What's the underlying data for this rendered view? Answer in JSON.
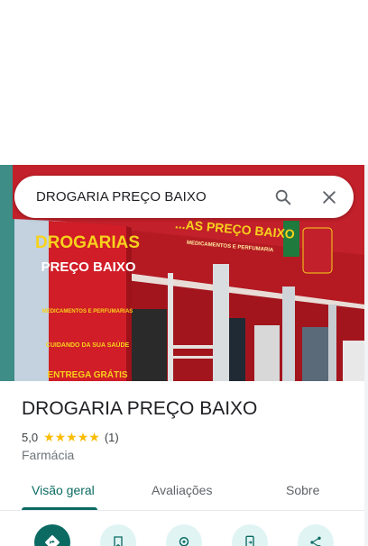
{
  "search": {
    "query": "DROGARIA PREÇO BAIXO",
    "search_icon": "search-icon",
    "close_icon": "close-icon"
  },
  "photo": {
    "sign_line1": "DROGARIAS",
    "sign_line2": "PREÇO BAIXO",
    "sign_line3": "MEDICAMENTOS E PERFUMARIAS",
    "sign_line4": "CUIDANDO DA SUA SAÚDE",
    "sign_line5": "ENTREGA GRÁTIS",
    "facade_text": "...AS PREÇO BAIXO",
    "facade_sub": "MEDICAMENTOS E PERFUMARIA",
    "colors": {
      "sign_red": "#cf1b24",
      "wall_red": "#b51a22",
      "sign_white": "#ffffff",
      "sign_yellow": "#f7d21c"
    }
  },
  "place": {
    "name": "DROGARIA PREÇO BAIXO",
    "rating": "5,0",
    "stars": "★★★★★",
    "reviews": "(1)",
    "category": "Farmácia"
  },
  "tabs": [
    {
      "label": "Visão geral",
      "active": true
    },
    {
      "label": "Avaliações",
      "active": false
    },
    {
      "label": "Sobre",
      "active": false
    }
  ],
  "actions": [
    {
      "icon": "directions-icon"
    },
    {
      "icon": "bookmark-icon"
    },
    {
      "icon": "nearby-icon"
    },
    {
      "icon": "send-to-phone-icon"
    },
    {
      "icon": "share-icon"
    }
  ],
  "colors": {
    "accent": "#0b6b63",
    "star": "#fbbc04",
    "action_bg": "#e0f4f3"
  }
}
